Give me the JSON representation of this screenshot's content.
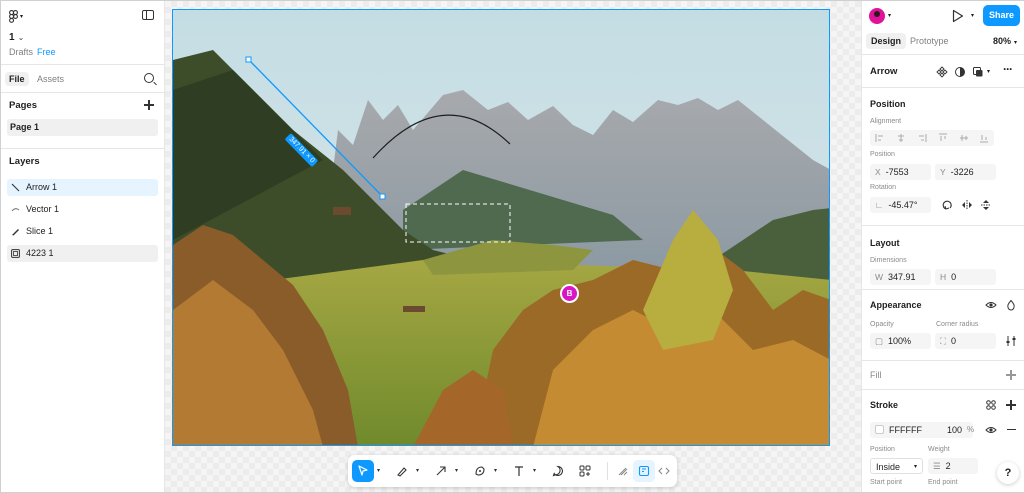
{
  "file": {
    "name": "1",
    "location": "Drafts",
    "plan": "Free"
  },
  "left_tabs": {
    "file": "File",
    "assets": "Assets"
  },
  "pages": {
    "title": "Pages",
    "items": [
      {
        "label": "Page 1"
      }
    ]
  },
  "layers": {
    "title": "Layers",
    "items": [
      {
        "label": "Arrow 1",
        "icon": "arrow-line-icon"
      },
      {
        "label": "Vector 1",
        "icon": "vector-path-icon"
      },
      {
        "label": "Slice 1",
        "icon": "slice-knife-icon"
      },
      {
        "label": "4223 1",
        "icon": "image-icon"
      }
    ]
  },
  "canvas": {
    "measure_label": "347.91 × 0",
    "collaborator_initial": "B",
    "selection_color": "#0d99ff"
  },
  "toolbar": {
    "tools": [
      "move-tool",
      "pen-tool",
      "arrow-tool",
      "shape-tool",
      "text-tool",
      "comment-tool",
      "components-tool",
      "draw-tool",
      "dev-mode-tool",
      "code-tool"
    ]
  },
  "right": {
    "share_label": "Share",
    "tabs": {
      "design": "Design",
      "prototype": "Prototype"
    },
    "zoom": "80%",
    "layer_name": "Arrow",
    "position": {
      "title": "Position",
      "alignment_label": "Alignment",
      "position_label": "Position",
      "x_prefix": "X",
      "x": "-7553",
      "y_prefix": "Y",
      "y": "-3226",
      "rotation_label": "Rotation",
      "rotation": "-45.47°"
    },
    "layout": {
      "title": "Layout",
      "dimensions_label": "Dimensions",
      "w_prefix": "W",
      "w": "347.91",
      "h_prefix": "H",
      "h": "0"
    },
    "appearance": {
      "title": "Appearance",
      "opacity_label": "Opacity",
      "opacity": "100%",
      "radius_label": "Corner radius",
      "radius": "0"
    },
    "fill": {
      "title": "Fill"
    },
    "stroke": {
      "title": "Stroke",
      "color": "FFFFFF",
      "opacity": "100",
      "unit": "%",
      "position_label": "Position",
      "position": "Inside",
      "weight_label": "Weight",
      "weight": "2",
      "start_label": "Start point",
      "end_label": "End point"
    },
    "help": "?"
  }
}
